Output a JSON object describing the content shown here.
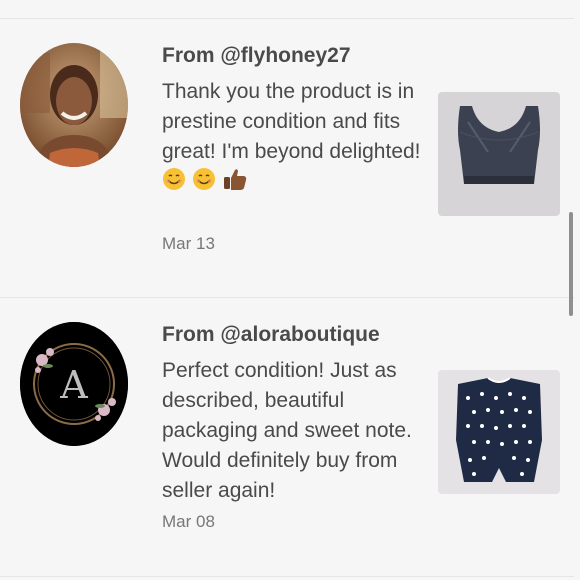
{
  "reviews": [
    {
      "author": "From @flyhoney27",
      "text": "Thank you the product is in prestine condition and fits great! I'm beyond delighted!",
      "date": "Mar 13"
    },
    {
      "author": "From @aloraboutique",
      "text": "Perfect condition! Just as described, beautiful packaging and sweet note. Would definitely buy from seller again!",
      "date": "Mar 08"
    }
  ],
  "avatar_letter": "A"
}
